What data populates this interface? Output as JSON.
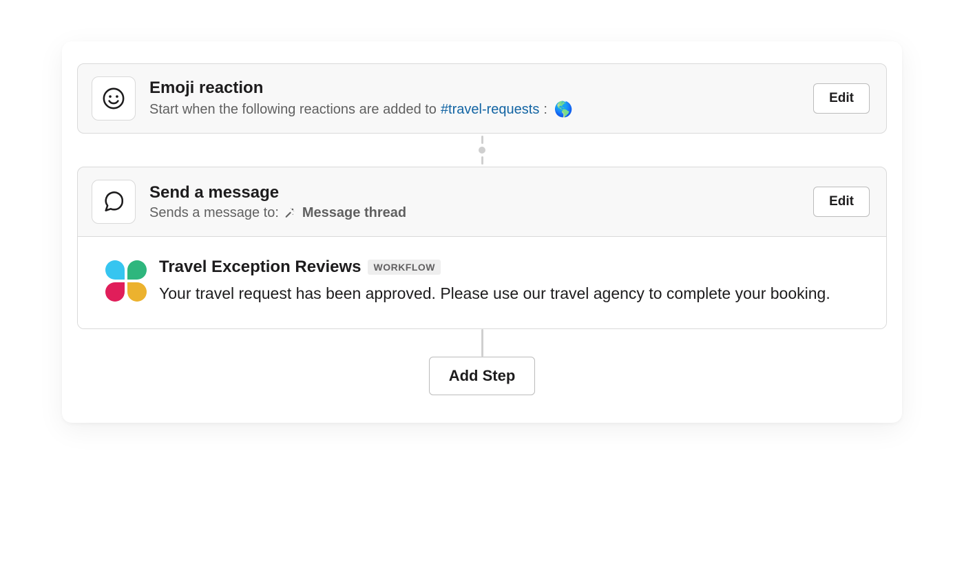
{
  "steps": [
    {
      "title": "Emoji reaction",
      "desc_prefix": "Start when the following reactions are added to",
      "channel": "#travel-requests",
      "desc_suffix": ":",
      "emoji": "🌎",
      "edit_label": "Edit"
    },
    {
      "title": "Send a message",
      "desc_prefix": "Sends a message to:",
      "thread_label": "Message thread",
      "edit_label": "Edit",
      "message": {
        "app_name": "Travel Exception Reviews",
        "badge": "WORKFLOW",
        "text": "Your travel request has been approved. Please use our travel agency to complete your booking."
      }
    }
  ],
  "add_step_label": "Add Step"
}
